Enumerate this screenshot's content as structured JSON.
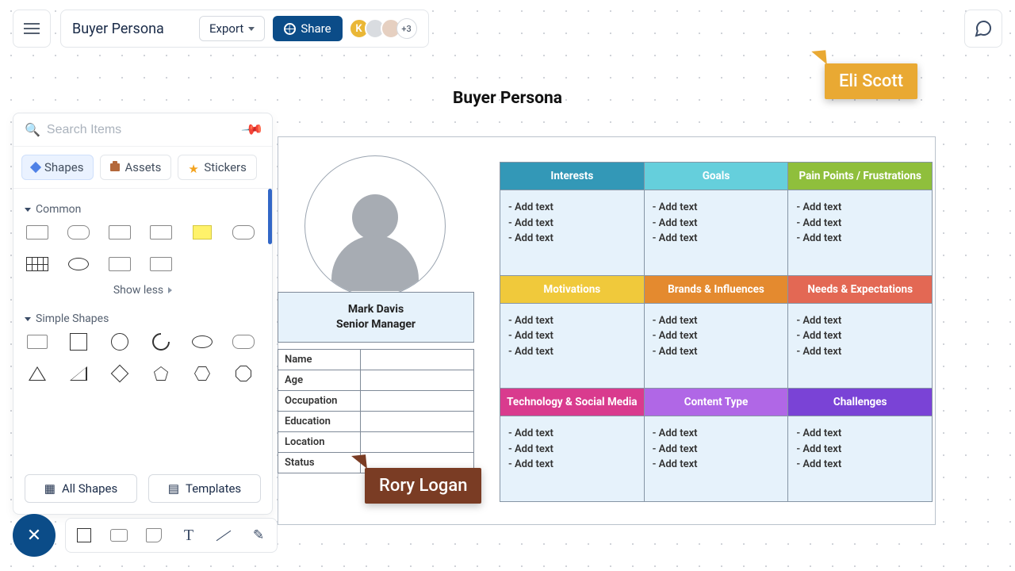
{
  "header": {
    "doc_title": "Buyer Persona",
    "export_label": "Export",
    "share_label": "Share",
    "avatar_k": "K",
    "avatar_plus": "+3"
  },
  "sidebar": {
    "search_placeholder": "Search Items",
    "tabs": {
      "shapes": "Shapes",
      "assets": "Assets",
      "stickers": "Stickers"
    },
    "section_common": "Common",
    "show_less": "Show less",
    "section_simple": "Simple Shapes",
    "all_shapes": "All Shapes",
    "templates": "Templates"
  },
  "canvas": {
    "title": "Buyer Persona"
  },
  "persona": {
    "name": "Mark Davis",
    "role": "Senior Manager",
    "attrs": [
      "Name",
      "Age",
      "Occupation",
      "Education",
      "Location",
      "Status"
    ]
  },
  "grid": {
    "headers": [
      [
        "Interests",
        "Goals",
        "Pain Points / Frustrations"
      ],
      [
        "Motivations",
        "Brands & Influences",
        "Needs & Expectations"
      ],
      [
        "Technology & Social Media",
        "Content Type",
        "Challenges"
      ]
    ],
    "colors": [
      [
        "#3398b7",
        "#65cfdc",
        "#8fbf3c"
      ],
      [
        "#f0c93b",
        "#e48a2f",
        "#e36854"
      ],
      [
        "#d93b8e",
        "#b067e6",
        "#7a43d6"
      ]
    ],
    "placeholder": "- Add text"
  },
  "cursors": {
    "eli": "Eli Scott",
    "rory": "Rory Logan"
  }
}
